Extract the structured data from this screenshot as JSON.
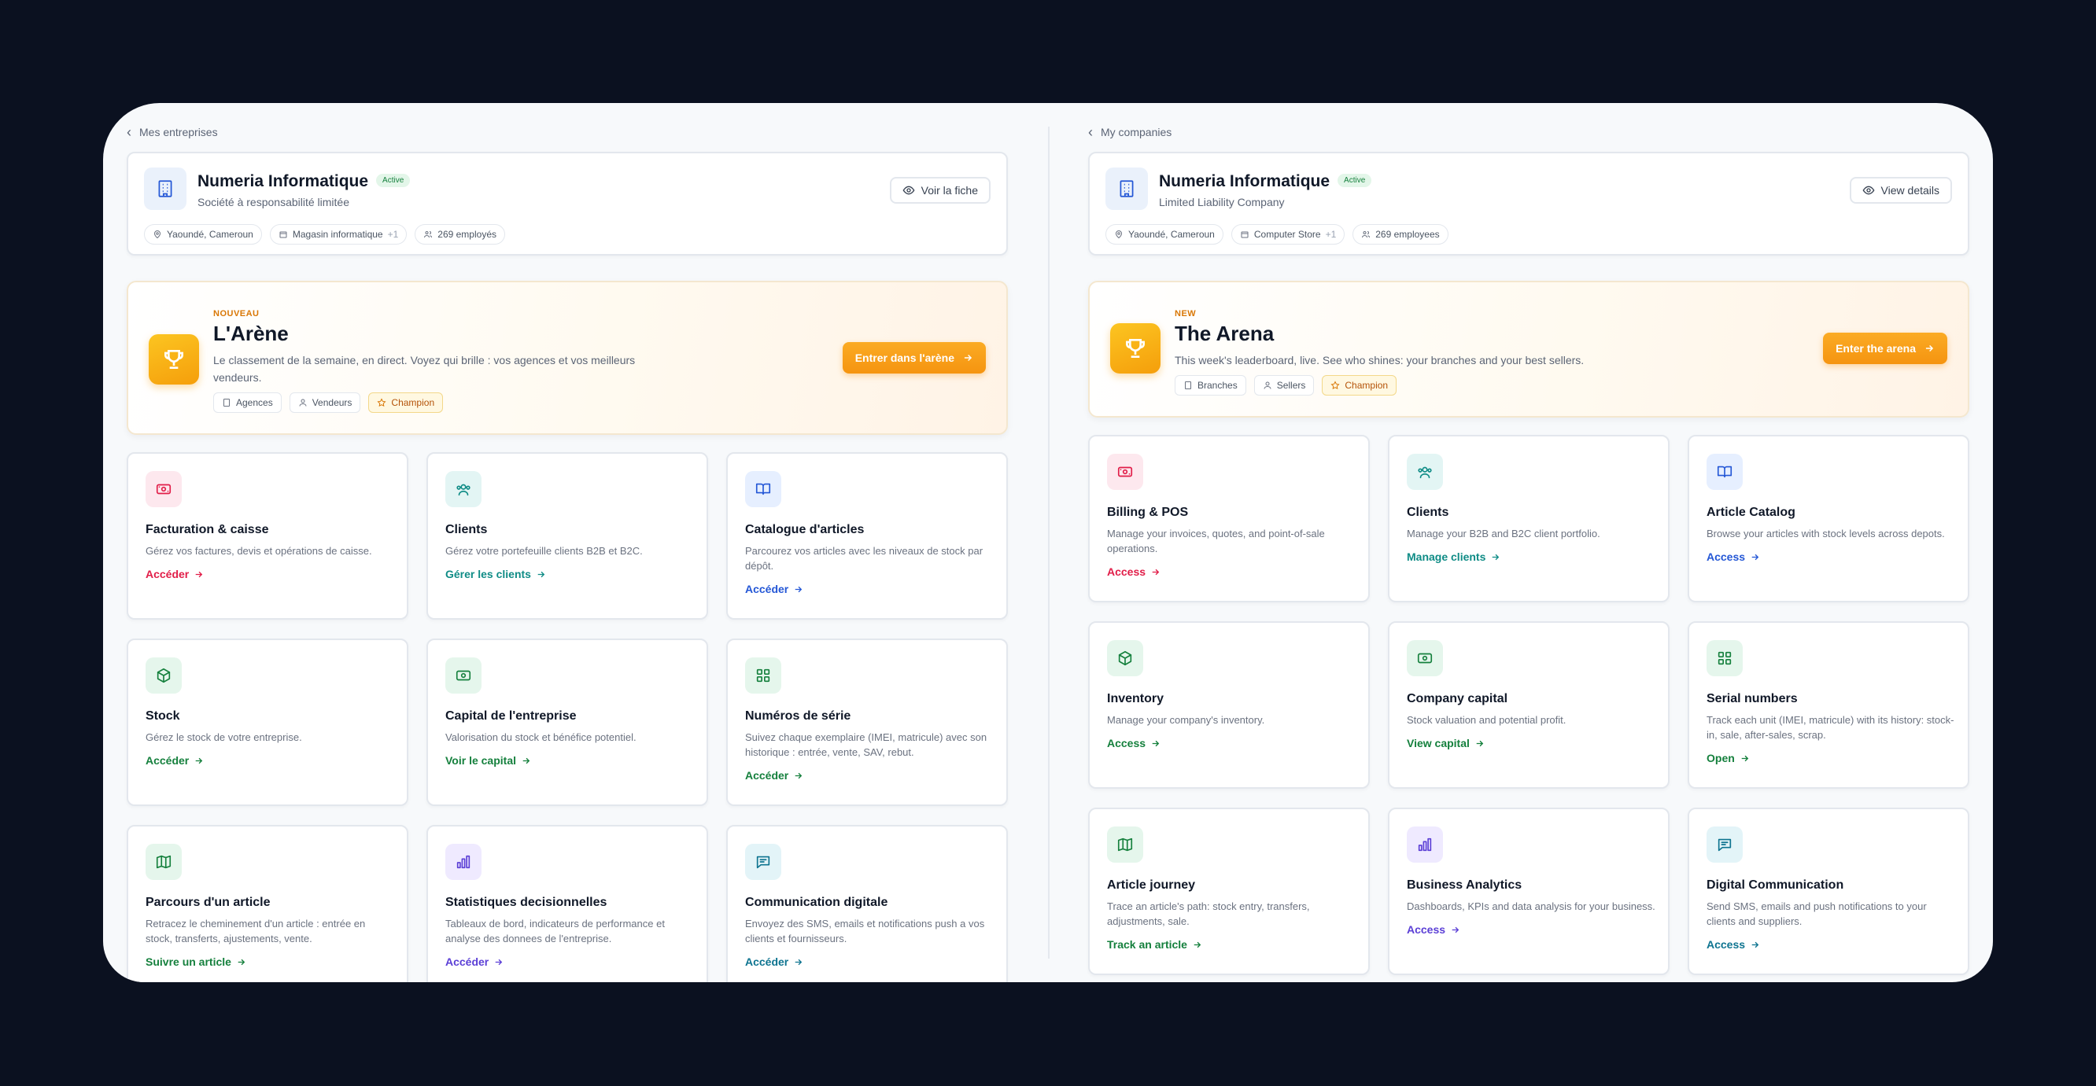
{
  "left": {
    "breadcrumb": "Mes entreprises",
    "company": {
      "name": "Numeria Informatique",
      "status": "Active",
      "type": "Société à responsabilité limitée",
      "details_button": "Voir la fiche",
      "location": "Yaoundé, Cameroun",
      "category": "Magasin informatique",
      "category_extra": "+1",
      "employees": "269 employés"
    },
    "arena": {
      "kicker": "NOUVEAU",
      "title": "L'Arène",
      "description": "Le classement de la semaine, en direct. Voyez qui brille : vos agences et vos meilleurs vendeurs.",
      "tags": [
        "Agences",
        "Vendeurs",
        "Champion"
      ],
      "button": "Entrer dans l'arène"
    },
    "cards": [
      {
        "title": "Facturation & caisse",
        "desc": "Gérez vos factures, devis et opérations de caisse.",
        "link": "Accéder"
      },
      {
        "title": "Clients",
        "desc": "Gérez votre portefeuille clients B2B et B2C.",
        "link": "Gérer les clients"
      },
      {
        "title": "Catalogue d'articles",
        "desc": "Parcourez vos articles avec les niveaux de stock par dépôt.",
        "link": "Accéder"
      },
      {
        "title": "Stock",
        "desc": "Gérez le stock de votre entreprise.",
        "link": "Accéder"
      },
      {
        "title": "Capital de l'entreprise",
        "desc": "Valorisation du stock et bénéfice potentiel.",
        "link": "Voir le capital"
      },
      {
        "title": "Numéros de série",
        "desc": "Suivez chaque exemplaire (IMEI, matricule) avec son historique : entrée, vente, SAV, rebut.",
        "link": "Accéder"
      },
      {
        "title": "Parcours d'un article",
        "desc": "Retracez le cheminement d'un article : entrée en stock, transferts, ajustements, vente.",
        "link": "Suivre un article"
      },
      {
        "title": "Statistiques decisionnelles",
        "desc": "Tableaux de bord, indicateurs de performance et analyse des donnees de l'entreprise.",
        "link": "Accéder"
      },
      {
        "title": "Communication digitale",
        "desc": "Envoyez des SMS, emails et notifications push a vos clients et fournisseurs.",
        "link": "Accéder"
      }
    ]
  },
  "right": {
    "breadcrumb": "My companies",
    "company": {
      "name": "Numeria Informatique",
      "status": "Active",
      "type": "Limited Liability Company",
      "details_button": "View details",
      "location": "Yaoundé, Cameroun",
      "category": "Computer Store",
      "category_extra": "+1",
      "employees": "269 employees"
    },
    "arena": {
      "kicker": "NEW",
      "title": "The Arena",
      "description": "This week's leaderboard, live. See who shines: your branches and your best sellers.",
      "tags": [
        "Branches",
        "Sellers",
        "Champion"
      ],
      "button": "Enter the arena"
    },
    "cards": [
      {
        "title": "Billing & POS",
        "desc": "Manage your invoices, quotes, and point-of-sale operations.",
        "link": "Access"
      },
      {
        "title": "Clients",
        "desc": "Manage your B2B and B2C client portfolio.",
        "link": "Manage clients"
      },
      {
        "title": "Article Catalog",
        "desc": "Browse your articles with stock levels across depots.",
        "link": "Access"
      },
      {
        "title": "Inventory",
        "desc": "Manage your company's inventory.",
        "link": "Access"
      },
      {
        "title": "Company capital",
        "desc": "Stock valuation and potential profit.",
        "link": "View capital"
      },
      {
        "title": "Serial numbers",
        "desc": "Track each unit (IMEI, matricule) with its history: stock-in, sale, after-sales, scrap.",
        "link": "Open"
      },
      {
        "title": "Article journey",
        "desc": "Trace an article's path: stock entry, transfers, adjustments, sale.",
        "link": "Track an article"
      },
      {
        "title": "Business Analytics",
        "desc": "Dashboards, KPIs and data analysis for your business.",
        "link": "Access"
      },
      {
        "title": "Digital Communication",
        "desc": "Send SMS, emails and push notifications to your clients and suppliers.",
        "link": "Access"
      }
    ]
  },
  "card_meta": [
    {
      "icon": "cash-register-icon",
      "color": "red",
      "hex": "#e11d48"
    },
    {
      "icon": "users-icon",
      "color": "teal",
      "hex": "#0f8c86"
    },
    {
      "icon": "book-icon",
      "color": "blue",
      "hex": "#2457d6"
    },
    {
      "icon": "box-icon",
      "color": "green",
      "hex": "#15803d"
    },
    {
      "icon": "banknote-icon",
      "color": "green",
      "hex": "#15803d"
    },
    {
      "icon": "grid-icon",
      "color": "green",
      "hex": "#15803d"
    },
    {
      "icon": "map-icon",
      "color": "green",
      "hex": "#15803d"
    },
    {
      "icon": "bar-chart-icon",
      "color": "purple",
      "hex": "#5b3fd6"
    },
    {
      "icon": "message-icon",
      "color": "cyan",
      "hex": "#0e7490"
    }
  ],
  "colors": {
    "accent_orange": "#f59410",
    "background_dark": "#0b1120",
    "surface": "#f7f9fb",
    "status_green": "#15803d"
  }
}
